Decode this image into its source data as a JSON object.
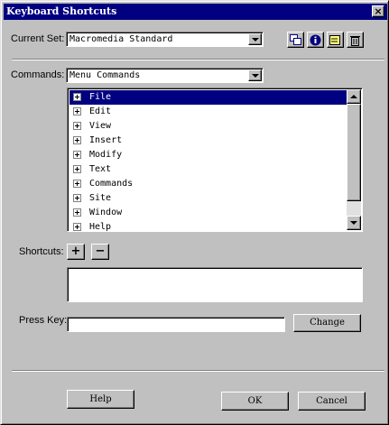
{
  "window": {
    "title": "Keyboard Shortcuts",
    "close_glyph": "×"
  },
  "current_set": {
    "label": "Current Set:",
    "value": "Macromedia Standard"
  },
  "toolbar": {
    "icons": [
      "duplicate-set-icon",
      "info-icon",
      "rename-set-icon",
      "delete-set-icon"
    ]
  },
  "commands": {
    "label": "Commands:",
    "value": "Menu Commands"
  },
  "command_list": {
    "items": [
      "File",
      "Edit",
      "View",
      "Insert",
      "Modify",
      "Text",
      "Commands",
      "Site",
      "Window",
      "Help"
    ],
    "selected_index": 0
  },
  "shortcuts": {
    "label": "Shortcuts:",
    "add": "+",
    "remove": "−"
  },
  "press_key": {
    "label": "Press Key:",
    "value": "",
    "change_button": "Change"
  },
  "footer": {
    "help": "Help",
    "ok": "OK",
    "cancel": "Cancel"
  },
  "colors": {
    "title_bar": "#000080",
    "face": "#c0c0c0",
    "selection": "#000080"
  }
}
